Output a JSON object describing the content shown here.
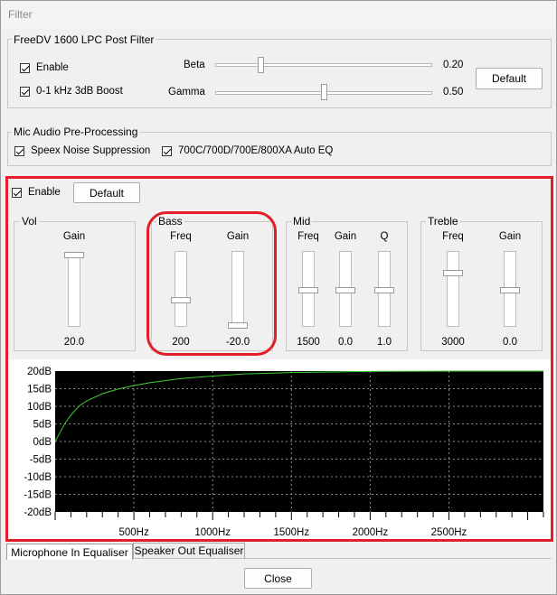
{
  "window": {
    "title": "Filter"
  },
  "lpc": {
    "legend": "FreeDV 1600 LPC Post Filter",
    "enable_label": "Enable",
    "boost_label": "0-1 kHz 3dB Boost",
    "beta_label": "Beta",
    "beta_value": "0.20",
    "beta_level": 0.2,
    "gamma_label": "Gamma",
    "gamma_value": "0.50",
    "gamma_level": 0.5,
    "default_label": "Default"
  },
  "mic": {
    "legend": "Mic Audio Pre-Processing",
    "speex_label": "Speex Noise Suppression",
    "autoeq_label": "700C/700D/700E/800XA Auto EQ"
  },
  "eq": {
    "enable_label": "Enable",
    "default_label": "Default",
    "vol": {
      "legend": "Vol",
      "gain_label": "Gain",
      "gain_value": "20.0",
      "gain_level": 1.0
    },
    "bass": {
      "legend": "Bass",
      "freq_label": "Freq",
      "freq_value": "200",
      "freq_level": 0.36,
      "gain_label": "Gain",
      "gain_value": "-20.0",
      "gain_level": 0.0
    },
    "mid": {
      "legend": "Mid",
      "freq_label": "Freq",
      "freq_value": "1500",
      "freq_level": 0.5,
      "gain_label": "Gain",
      "gain_value": "0.0",
      "gain_level": 0.5,
      "q_label": "Q",
      "q_value": "1.0",
      "q_level": 0.5
    },
    "treble": {
      "legend": "Treble",
      "freq_label": "Freq",
      "freq_value": "3000",
      "freq_level": 0.74,
      "gain_label": "Gain",
      "gain_value": "0.0",
      "gain_level": 0.5
    }
  },
  "chart_data": {
    "type": "line",
    "title": "",
    "xlabel": "",
    "ylabel": "",
    "xlim": [
      0,
      3100
    ],
    "ylim": [
      -20,
      20
    ],
    "x_ticks": [
      500,
      1000,
      1500,
      2000,
      2500
    ],
    "x_tick_labels": [
      "500Hz",
      "1000Hz",
      "1500Hz",
      "2000Hz",
      "2500Hz"
    ],
    "y_ticks": [
      20,
      15,
      10,
      5,
      0,
      -5,
      -10,
      -15,
      -20
    ],
    "y_tick_labels": [
      "20dB",
      "15dB",
      "10dB",
      "5dB",
      "0dB",
      "-5dB",
      "-10dB",
      "-15dB",
      "-20dB"
    ],
    "grid": true,
    "background": "#000000",
    "line_color": "#3fcf2f",
    "series": [
      {
        "x": [
          0,
          30,
          60,
          100,
          150,
          200,
          300,
          400,
          500,
          600,
          800,
          1000,
          1200,
          1500,
          2000,
          2500,
          3000,
          3100
        ],
        "y": [
          0,
          2.5,
          5,
          7.5,
          10,
          11.5,
          13.6,
          14.9,
          15.9,
          16.7,
          17.9,
          18.6,
          19.2,
          19.6,
          19.9,
          20,
          20,
          20
        ]
      }
    ]
  },
  "tabs": {
    "mic_label": "Microphone In Equaliser",
    "spk_label": "Speaker Out Equaliser"
  },
  "close_label": "Close"
}
